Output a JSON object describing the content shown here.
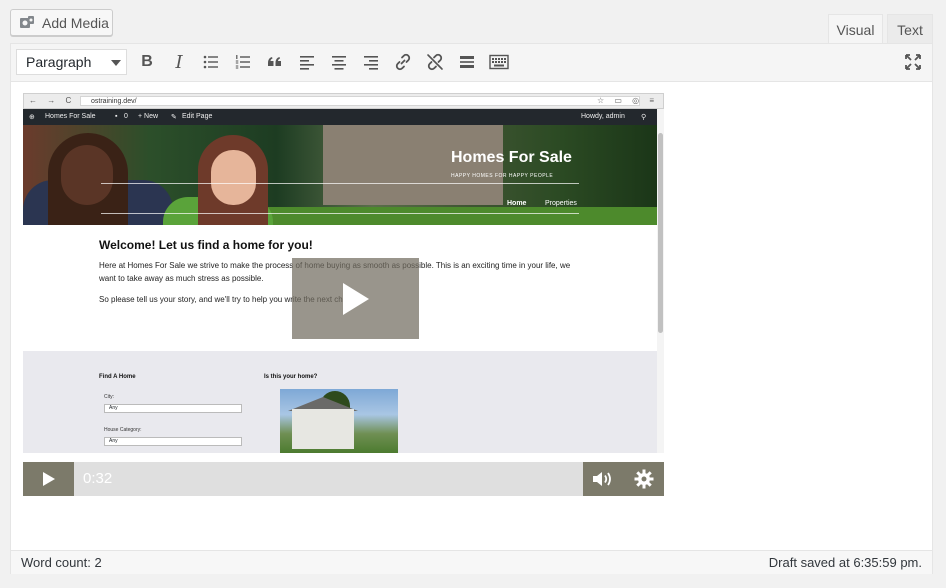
{
  "add_media": {
    "label": "Add Media",
    "icon": "media-camera-icon"
  },
  "tabs": [
    {
      "label": "Visual",
      "active": true
    },
    {
      "label": "Text",
      "active": false
    }
  ],
  "toolbar": {
    "format_value": "Paragraph",
    "buttons": [
      "bold",
      "italic",
      "bulleted-list",
      "numbered-list",
      "blockquote",
      "align-left",
      "align-center",
      "align-right",
      "insert-link",
      "remove-link",
      "read-more",
      "toolbar-toggle"
    ],
    "bold_glyph": "B",
    "italic_glyph": "I",
    "fullscreen_icon": "fullscreen-icon"
  },
  "video": {
    "browser": {
      "nav": "← → C ⌂",
      "url": "ostraining.dev/",
      "right": "☆ ▭ ◎ ≡"
    },
    "admin_bar": {
      "site": "Homes For Sale",
      "comments": "0",
      "new": "+ New",
      "edit": "Edit Page",
      "howdy": "Howdy, admin"
    },
    "hero": {
      "title": "Homes For Sale",
      "tagline": "HAPPY HOMES FOR HAPPY PEOPLE",
      "nav_home": "Home",
      "nav_properties": "Properties"
    },
    "welcome": "Welcome! Let us find a home for you!",
    "para1": "Here at Homes For Sale we strive to make the process of home buying as smooth as possible.  This is an exciting time in your life, we want to take away as much stress as possible.",
    "para2": "So please tell us your story, and we'll try to help you write the next chapter!",
    "find_home": "Find A Home",
    "is_this_home": "Is this your home?",
    "city_label": "City:",
    "city_value": "Any",
    "category_label": "House Category:",
    "category_value": "Any",
    "time": "0:32"
  },
  "status": {
    "word_count": "Word count: 2",
    "draft_saved": "Draft saved at 6:35:59 pm."
  }
}
